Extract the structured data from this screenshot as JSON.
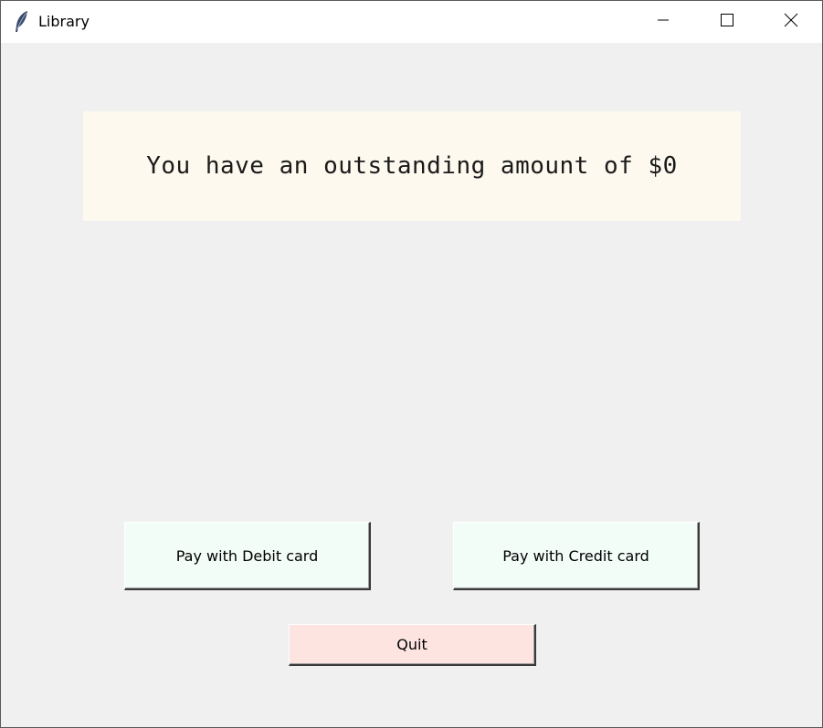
{
  "window": {
    "title": "Library",
    "icon": "feather-icon",
    "controls": {
      "minimize": "minimize-icon",
      "maximize": "maximize-icon",
      "close": "close-icon"
    }
  },
  "main": {
    "amount_message": "You have an outstanding amount of $0"
  },
  "buttons": {
    "debit_label": "Pay with Debit card",
    "credit_label": "Pay with Credit card",
    "quit_label": "Quit"
  },
  "colors": {
    "window_bg": "#f0f0f0",
    "panel_bg": "#fdf9ee",
    "pay_button_bg": "#f2fdf8",
    "quit_button_bg": "#fde4e1"
  }
}
